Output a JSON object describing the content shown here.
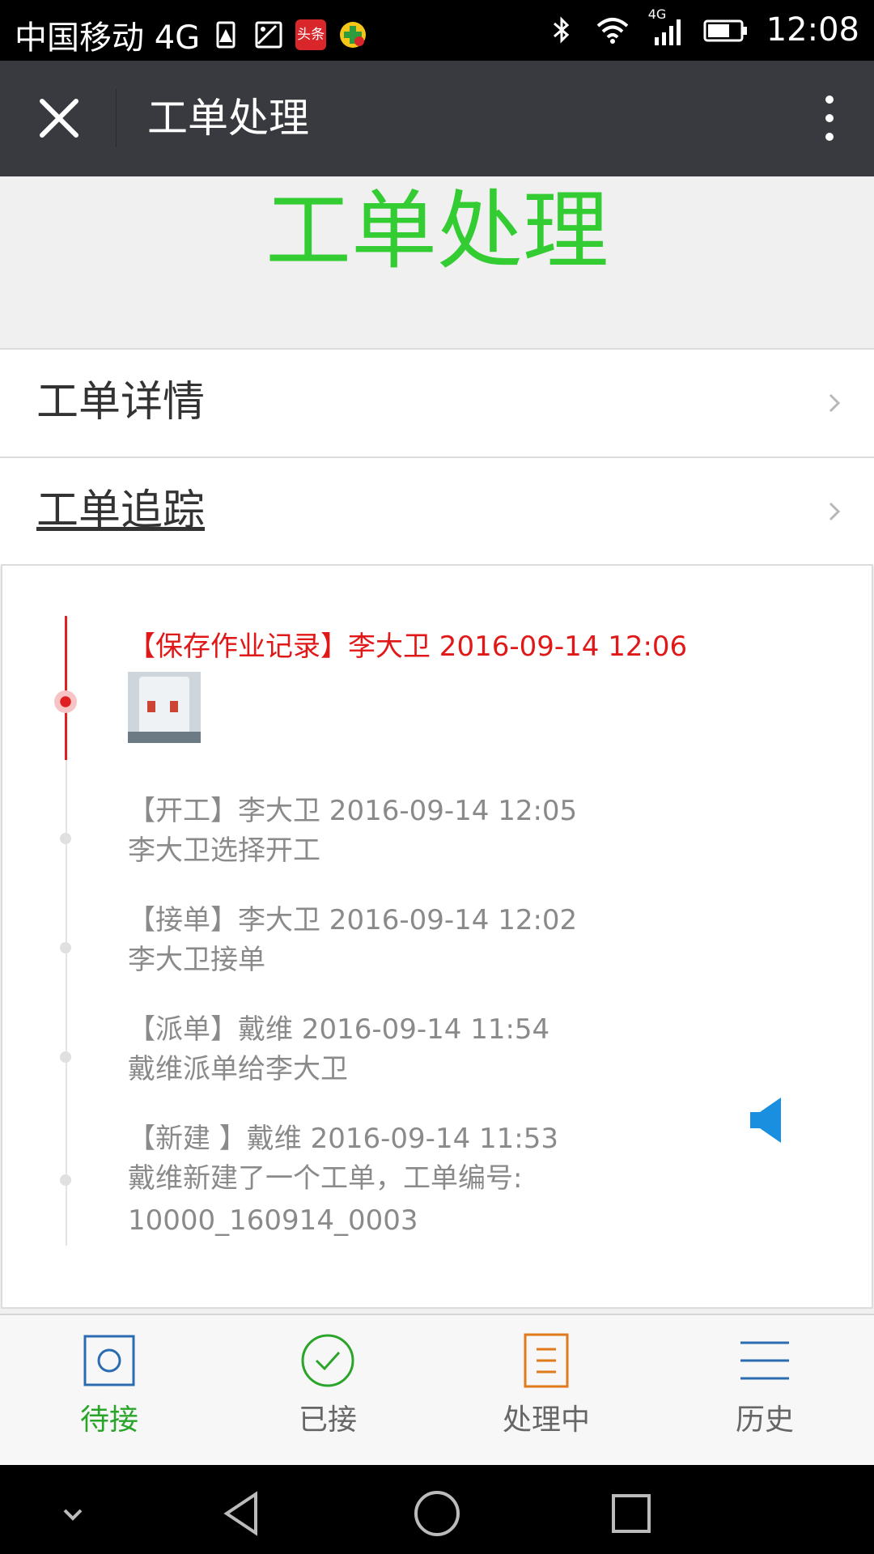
{
  "status_bar": {
    "carrier": "中国移动 4G",
    "network_badge": "4G",
    "app_icon_text": "头条",
    "time": "12:08",
    "icons": [
      "sim-alert-icon",
      "image-icon",
      "toutiao-app-icon",
      "game-app-icon",
      "bluetooth-icon",
      "wifi-icon",
      "signal-icon",
      "battery-icon"
    ]
  },
  "titlebar": {
    "title": "工单处理",
    "close_icon": "close-icon",
    "more_icon": "more-vertical-icon"
  },
  "page_header": {
    "heading": "工单处理",
    "color": "#33cc33"
  },
  "menu": [
    {
      "label": "工单详情"
    },
    {
      "label": "工单追踪"
    }
  ],
  "timeline": [
    {
      "head": "【保存作业记录】李大卫 2016-09-14 12:06",
      "desc": "",
      "has_image": true,
      "active": true
    },
    {
      "head": "【开工】李大卫 2016-09-14 12:05",
      "desc": "李大卫选择开工"
    },
    {
      "head": "【接单】李大卫 2016-09-14 12:02",
      "desc": "李大卫接单"
    },
    {
      "head": "【派单】戴维 2016-09-14 11:54",
      "desc": "戴维派单给李大卫"
    },
    {
      "head": "【新建 】戴维 2016-09-14 11:53",
      "desc": "戴维新建了一个工单，工单编号:",
      "desc2": "10000_160914_0003"
    }
  ],
  "tabs": [
    {
      "label": "待接",
      "icon": "pending-icon",
      "active": true
    },
    {
      "label": "已接",
      "icon": "check-circle-icon"
    },
    {
      "label": "处理中",
      "icon": "document-icon"
    },
    {
      "label": "历史",
      "icon": "list-icon"
    }
  ],
  "colors": {
    "active_red": "#e01818",
    "tab_active": "#2aa52a",
    "titlebar_bg": "#393a3f"
  }
}
